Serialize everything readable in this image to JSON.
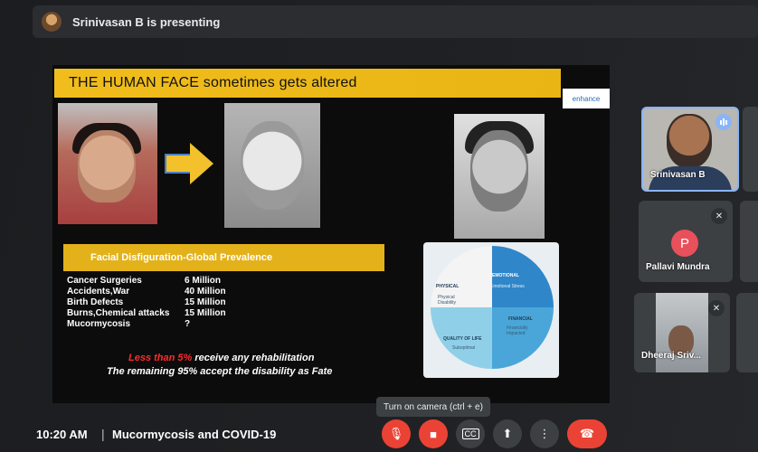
{
  "presenter_banner": {
    "text": "Srinivasan B is presenting"
  },
  "slide": {
    "title": "THE HUMAN FACE sometimes gets altered",
    "logo_text": "enhance",
    "subtitle": "Facial  Disfiguration-Global Prevalence",
    "stats": [
      {
        "label": "Cancer Surgeries",
        "value": "6 Million"
      },
      {
        "label": "Accidents,War",
        "value": "40 Million"
      },
      {
        "label": "Birth  Defects",
        "value": "15 Million"
      },
      {
        "label": "Burns,Chemical attacks",
        "value": "15 Million"
      },
      {
        "label": "Mucormycosis",
        "value": "?"
      }
    ],
    "note_red": "Less than 5%",
    "note_rest": " receive any rehabilitation",
    "note2": "The remaining 95% accept the disability as Fate",
    "puzzle": {
      "emotional": "EMOTIONAL",
      "emotional_sub": "Emotional Stress",
      "physical": "PHYSICAL",
      "physical_sub": "Physical Disability",
      "financial": "FINANCIAL",
      "financial_sub": "Financially Impacted",
      "quality": "QUALITY OF LIFE",
      "quality_sub": "Suboptimal"
    }
  },
  "participants": [
    {
      "name": "Srinivasan B"
    },
    {
      "name": "Pallavi Mundra",
      "initial": "P"
    },
    {
      "name": "Dheeraj Sriv..."
    }
  ],
  "tooltip": "Turn on camera (ctrl + e)",
  "bottom": {
    "time": "10:20 AM",
    "separator": "|",
    "meeting_title": "Mucormycosis and COVID-19"
  },
  "colors": {
    "accent_yellow": "#f1bd1c",
    "danger_red": "#ea4335",
    "tile_bg": "#3c4043"
  }
}
